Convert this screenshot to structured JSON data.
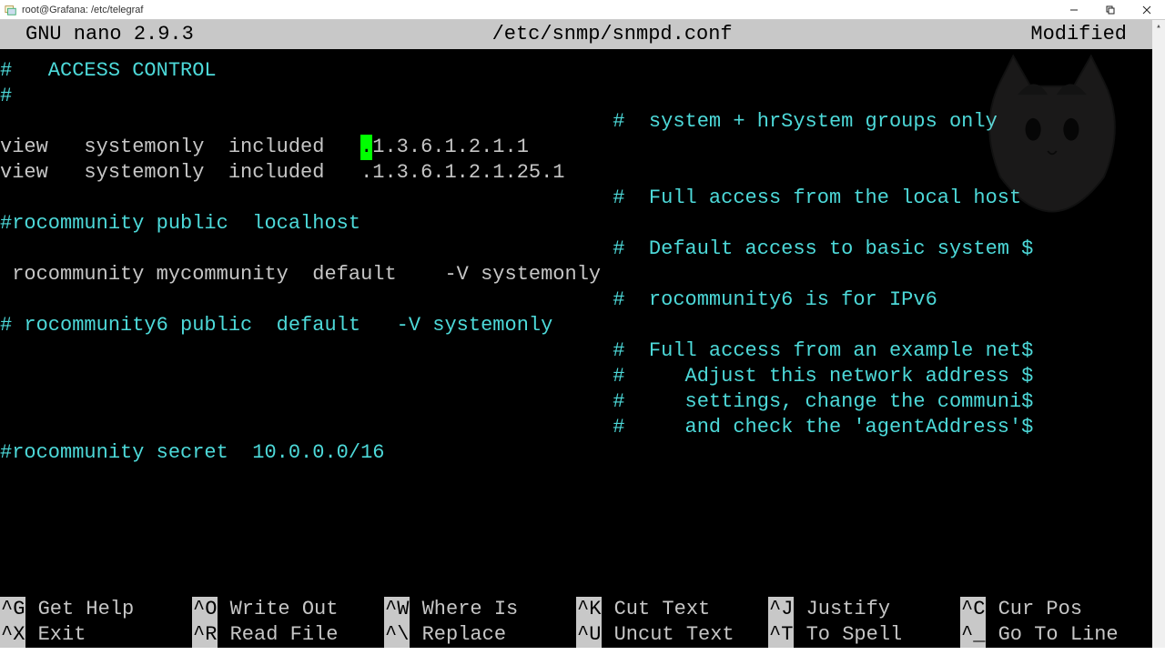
{
  "window": {
    "title": "root@Grafana: /etc/telegraf"
  },
  "nano_header": {
    "version": "GNU nano 2.9.3",
    "file": "/etc/snmp/snmpd.conf",
    "status": "Modified"
  },
  "lines": {
    "l01": "#   ACCESS CONTROL",
    "l02": "#",
    "l03": "",
    "l04_a": "                                                   #  system + hrSystem groups only",
    "l05_a": "view   systemonly  included   ",
    "l05_b": "1.3.6.1.2.1.1",
    "l06": "view   systemonly  included   .1.3.6.1.2.1.25.1",
    "l07": "",
    "l08": "                                                   #  Full access from the local host",
    "l09": "#rocommunity public  localhost",
    "l10": "                                                   #  Default access to basic system $",
    "l11_a": " rocommunity mycommunity  default    -V systemonly",
    "l12": "                                                   #  rocommunity6 is for IPv6",
    "l13": "# rocommunity6 public  default   -V systemonly",
    "l14": "",
    "l15": "                                                   #  Full access from an example net$",
    "l16": "                                                   #     Adjust this network address $",
    "l17": "                                                   #     settings, change the communi$",
    "l18": "                                                   #     and check the 'agentAddress'$",
    "l19": "#rocommunity secret  10.0.0.0/16"
  },
  "footer": {
    "r1": [
      {
        "k": "^G",
        "t": " Get Help"
      },
      {
        "k": "^O",
        "t": " Write Out"
      },
      {
        "k": "^W",
        "t": " Where Is"
      },
      {
        "k": "^K",
        "t": " Cut Text"
      },
      {
        "k": "^J",
        "t": " Justify"
      },
      {
        "k": "^C",
        "t": " Cur Pos"
      }
    ],
    "r2": [
      {
        "k": "^X",
        "t": " Exit"
      },
      {
        "k": "^R",
        "t": " Read File"
      },
      {
        "k": "^\\",
        "t": " Replace"
      },
      {
        "k": "^U",
        "t": " Uncut Text"
      },
      {
        "k": "^T",
        "t": " To Spell"
      },
      {
        "k": "^_",
        "t": " Go To Line"
      }
    ]
  }
}
